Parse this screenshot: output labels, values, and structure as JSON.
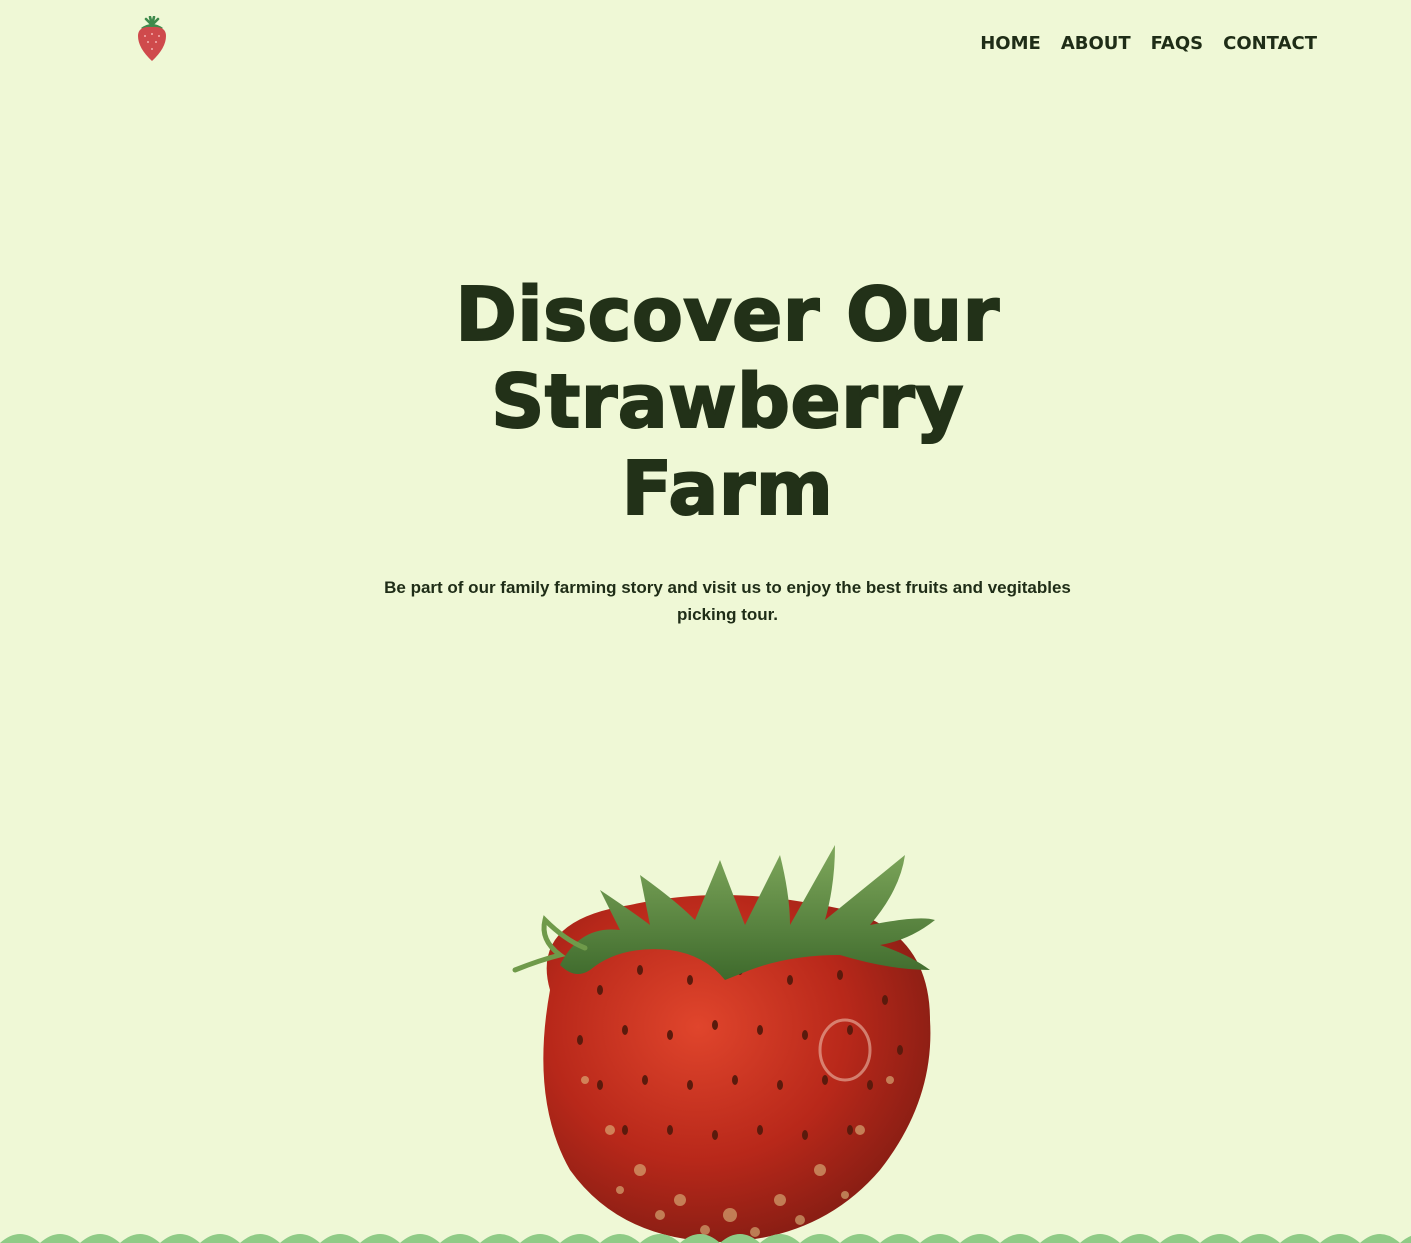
{
  "header": {
    "logo_icon": "strawberry-logo-icon",
    "nav": [
      {
        "label": "HOME"
      },
      {
        "label": "ABOUT"
      },
      {
        "label": "FAQS"
      },
      {
        "label": "CONTACT"
      }
    ]
  },
  "hero": {
    "title_lines": [
      "Discover Our",
      "Strawberry",
      "Farm"
    ],
    "subtitle": "Be part of our family farming story and visit us to enjoy the best fruits and vegitables picking tour.",
    "image_icon": "strawberry-photo"
  },
  "colors": {
    "background": "#eff8d6",
    "text": "#1f2d17",
    "wave": "#8fcb86",
    "berry": "#c8331f",
    "leaf": "#5e8a3a"
  }
}
